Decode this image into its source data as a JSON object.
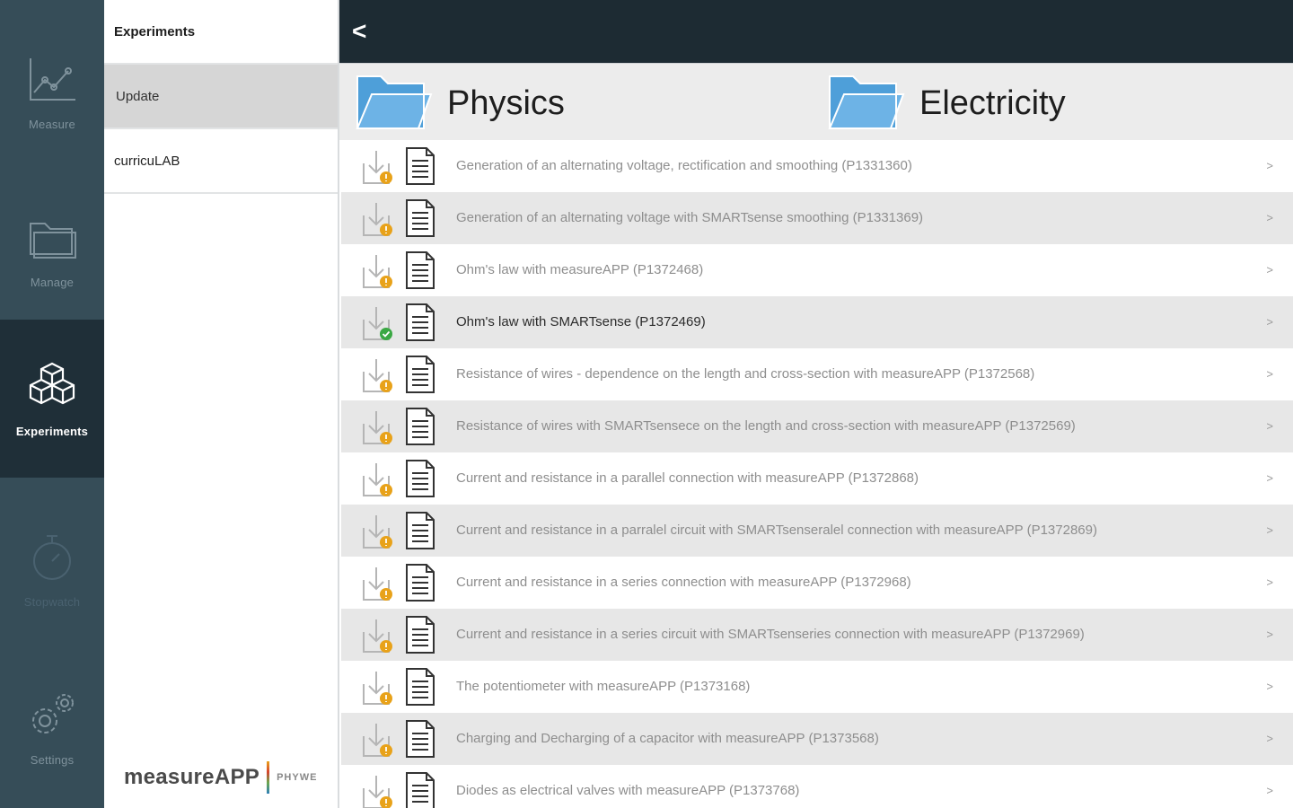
{
  "rail": {
    "items": [
      {
        "label": "Measure",
        "icon": "line-chart-icon"
      },
      {
        "label": "Manage",
        "icon": "folder-icon"
      },
      {
        "label": "Experiments",
        "icon": "cubes-icon"
      },
      {
        "label": "Stopwatch",
        "icon": "stopwatch-icon"
      },
      {
        "label": "Settings",
        "icon": "gears-icon"
      }
    ]
  },
  "menu": {
    "header": "Experiments",
    "items": [
      "Update",
      "curricuLAB"
    ],
    "selected": "Update"
  },
  "brand": {
    "name": "measureAPP",
    "company": "PHYWE"
  },
  "topbar": {
    "back_label": "<"
  },
  "breadcrumb": [
    "Physics",
    "Electricity"
  ],
  "colors": {
    "folder": "#4e9fd9",
    "badge_pending": "#e8a21a",
    "badge_done": "#3aa843",
    "accent_dark": "#1d2b33"
  },
  "experiments": [
    {
      "title": "Generation of an alternating voltage, rectification and smoothing (P1331360)",
      "status": "pending"
    },
    {
      "title": "Generation of an alternating voltage with SMARTsense smoothing (P1331369)",
      "status": "pending"
    },
    {
      "title": "Ohm's law with measureAPP (P1372468)",
      "status": "pending"
    },
    {
      "title": "Ohm's law with SMARTsense (P1372469)",
      "status": "downloaded"
    },
    {
      "title": "Resistance of wires - dependence on the length and cross-section with measureAPP (P1372568)",
      "status": "pending"
    },
    {
      "title": "Resistance of wires with SMARTsensece on the length and cross-section with measureAPP (P1372569)",
      "status": "pending"
    },
    {
      "title": "Current and resistance in a parallel connection with measureAPP (P1372868)",
      "status": "pending"
    },
    {
      "title": "Current and resistance in a parralel circuit with SMARTsenseralel connection with measureAPP (P1372869)",
      "status": "pending"
    },
    {
      "title": "Current and resistance in a series connection with measureAPP (P1372968)",
      "status": "pending"
    },
    {
      "title": "Current and resistance in a series circuit with SMARTsenseries connection with measureAPP (P1372969)",
      "status": "pending"
    },
    {
      "title": "The potentiometer with measureAPP (P1373168)",
      "status": "pending"
    },
    {
      "title": "Charging and Decharging of a capacitor with measureAPP (P1373568)",
      "status": "pending"
    },
    {
      "title": "Diodes as electrical valves with measureAPP (P1373768)",
      "status": "pending"
    }
  ],
  "row_chevron": ">"
}
